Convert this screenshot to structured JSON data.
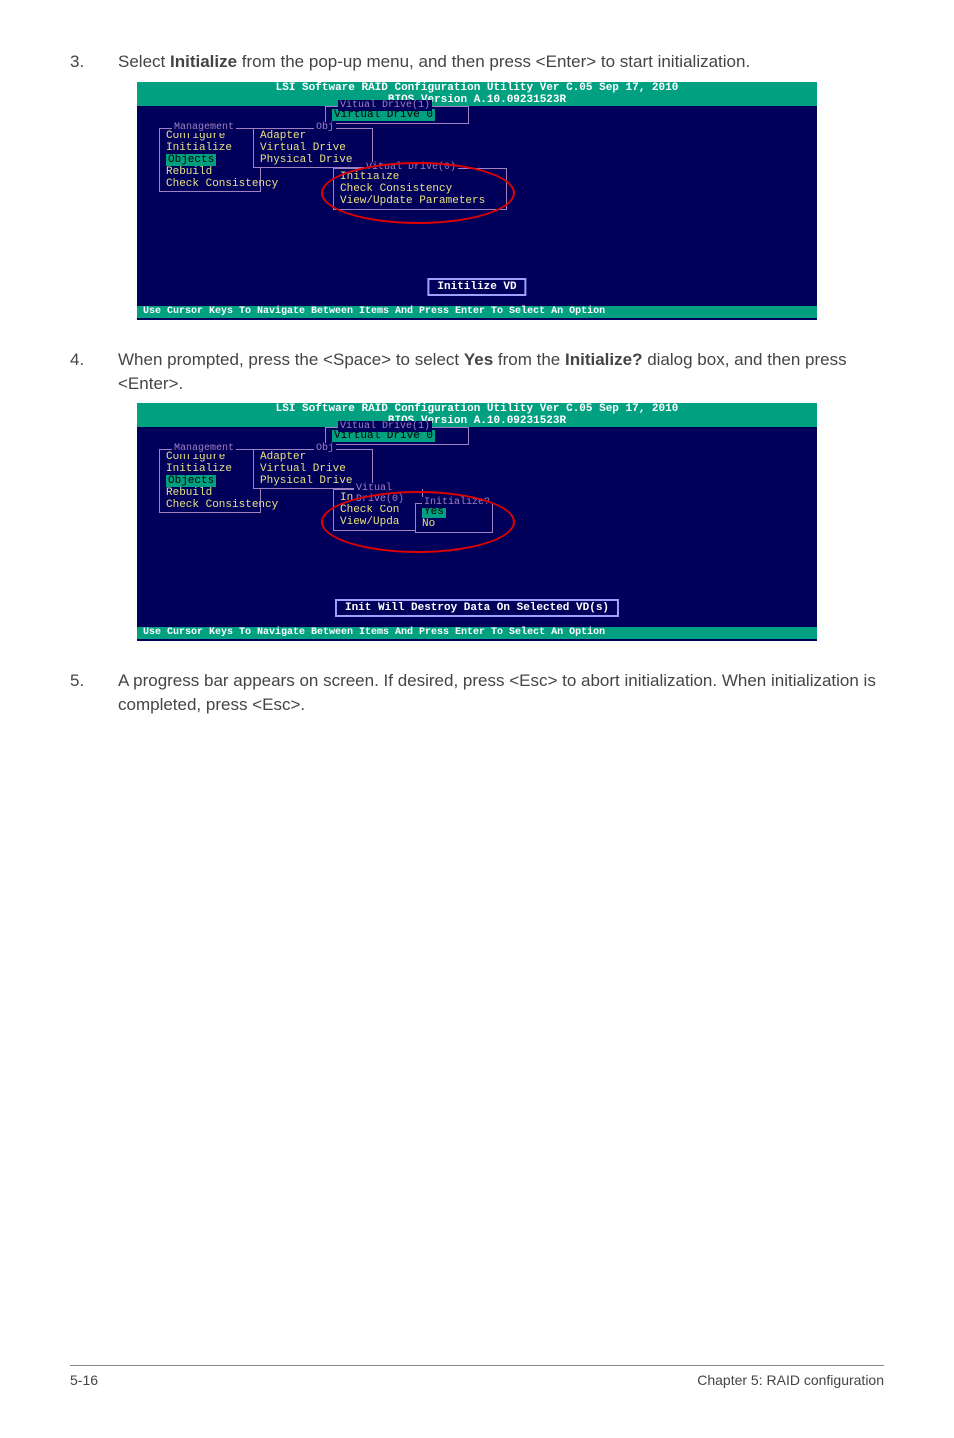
{
  "step3": {
    "num": "3.",
    "text_before": "Select ",
    "bold1": "Initialize",
    "text_after": " from the pop-up menu, and then press <Enter> to start initialization."
  },
  "step4": {
    "num": "4.",
    "text_before": "When prompted, press the <Space> to select ",
    "bold1": "Yes",
    "text_mid": " from the ",
    "bold2": "Initialize?",
    "text_after": " dialog box, and then press <Enter>."
  },
  "step5": {
    "num": "5.",
    "text": "A progress bar appears on screen. If desired, press <Esc> to abort initialization. When initialization is completed, press <Esc>."
  },
  "bios_common": {
    "title_line1": "LSI Software RAID Configuration Utility Ver C.05 Sep 17, 2010",
    "title_line2": "BIOS Version   A.10.09231523R",
    "footer": "Use Cursor Keys To Navigate Between Items And Press Enter To Select An Option",
    "mgmt_legend": "Management",
    "mgmt_items": [
      "Configure",
      "Initialize",
      "Objects",
      "Rebuild",
      "Check Consistency"
    ],
    "obj_legend": "Obj",
    "obj_items": [
      "Adapter",
      "Virtual Drive",
      "Physical Drive"
    ],
    "vd1_legend": "Vitual Drive(1)",
    "vd1_item": "Virtual Drive 0",
    "vd0_legend": "Vitual Drive(0)"
  },
  "bios1": {
    "vd0_items": [
      "Initialze",
      "Check Consistency",
      "View/Update Parameters"
    ],
    "status": "Initilize VD"
  },
  "bios2": {
    "vd0_items": [
      "Initialze",
      "Check Con",
      "View/Upda"
    ],
    "init_legend": "Initialize?",
    "init_items": [
      "Yes",
      "No"
    ],
    "status": "Init Will Destroy Data On Selected VD(s)"
  },
  "footer": {
    "left": "5-16",
    "right": "Chapter 5: RAID configuration"
  }
}
